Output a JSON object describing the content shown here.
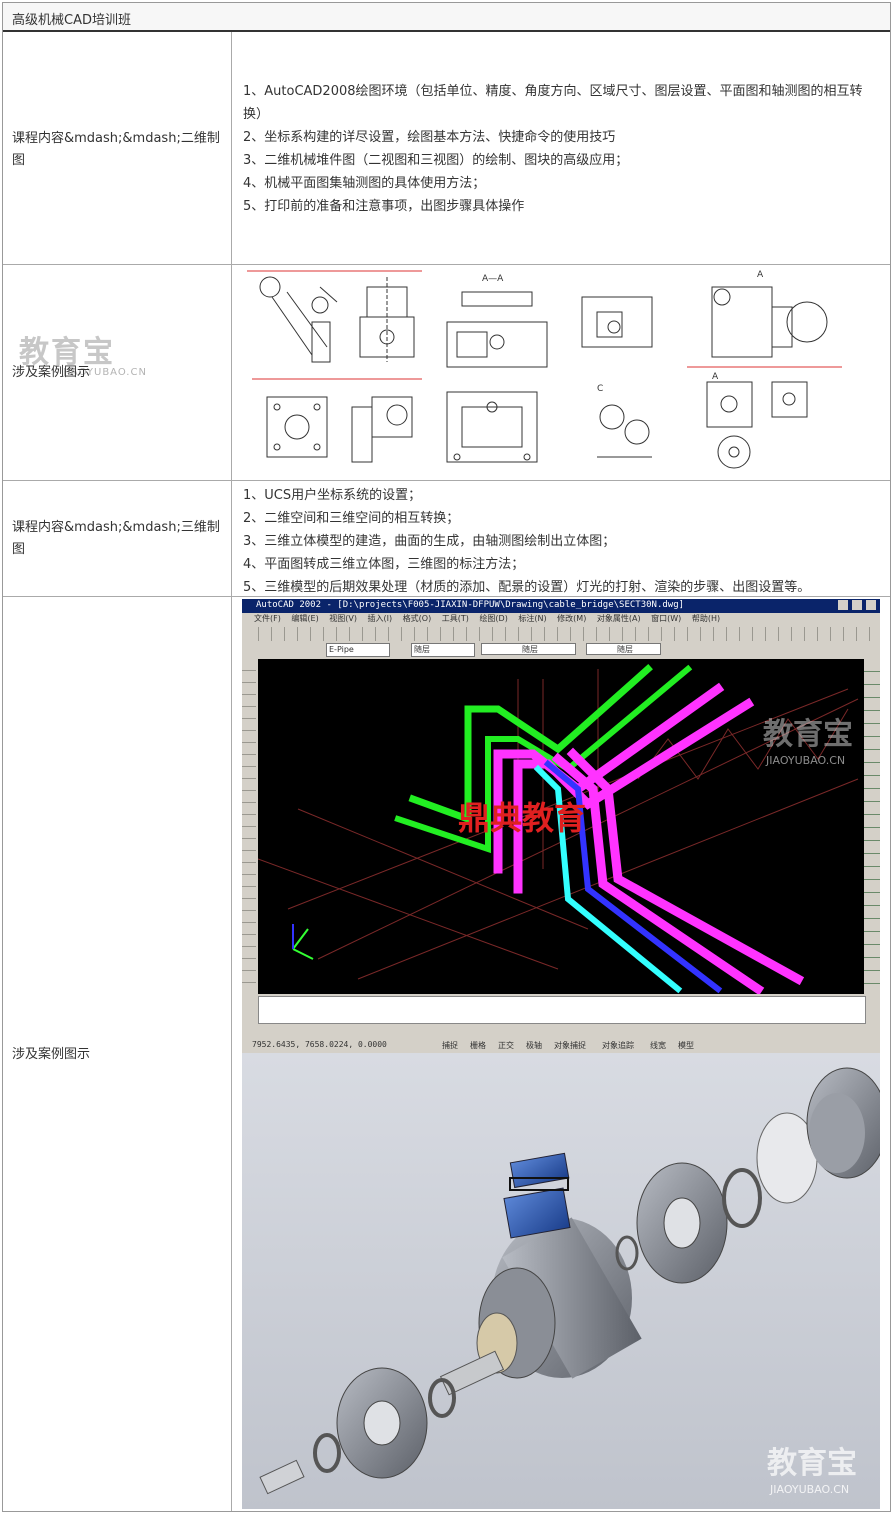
{
  "table_title": "高级机械CAD培训班",
  "row1": {
    "label": "课程内容&mdash;&mdash;二维制图",
    "items": [
      "1、AutoCAD2008绘图环境（包括单位、精度、角度方向、区域尺寸、图层设置、平面图和轴测图的相互转换）",
      "2、坐标系构建的详尽设置，绘图基本方法、快捷命令的使用技巧",
      "3、二维机械堆件图（二视图和三视图）的绘制、图块的高级应用；",
      "4、机械平面图集轴测图的具体使用方法；",
      "5、打印前的准备和注意事项，出图步骤具体操作"
    ]
  },
  "row2": {
    "label": "涉及案例图示",
    "watermark": "教育宝",
    "watermark_sub": "JIAOYUBAO.CN",
    "drawing_labels": [
      "A—A",
      "C",
      "A",
      "A"
    ]
  },
  "row3": {
    "label": "课程内容&mdash;&mdash;三维制图",
    "items": [
      "1、UCS用户坐标系统的设置；",
      "2、二维空间和三维空间的相互转换；",
      "3、三维立体模型的建造，曲面的生成，由轴测图绘制出立体图；",
      "4、平面图转成三维立体图，三维图的标注方法；",
      "5、三维模型的后期效果处理（材质的添加、配景的设置）灯光的打射、渲染的步骤、出图设置等。"
    ]
  },
  "row4": {
    "label": "涉及案例图示",
    "cad_title": "AutoCAD 2002 - [D:\\projects\\F005-JIAXIN-DFPUW\\Drawing\\cable_bridge\\SECT30N.dwg]",
    "cad_menu": [
      "文件(F)",
      "编辑(E)",
      "视图(V)",
      "插入(I)",
      "格式(O)",
      "工具(T)",
      "绘图(D)",
      "标注(N)",
      "修改(M)",
      "对象属性(A)",
      "窗口(W)",
      "帮助(H)"
    ],
    "cad_layer": "E-Pipe",
    "cad_linetype": "随层",
    "cad_coords": "7952.6435, 7658.0224, 0.0000",
    "cad_status": [
      "捕捉",
      "栅格",
      "正交",
      "极轴",
      "对象捕捉",
      "对象追踪",
      "线宽",
      "模型"
    ],
    "overlay_text": "鼎典教育",
    "watermark": "教育宝",
    "watermark_sub": "JIAOYUBAO.CN",
    "colors": {
      "green": "#22ee22",
      "magenta": "#ff33ff",
      "cyan": "#33ffff",
      "blue": "#3333ff",
      "overlay_red": "#e02020"
    }
  }
}
